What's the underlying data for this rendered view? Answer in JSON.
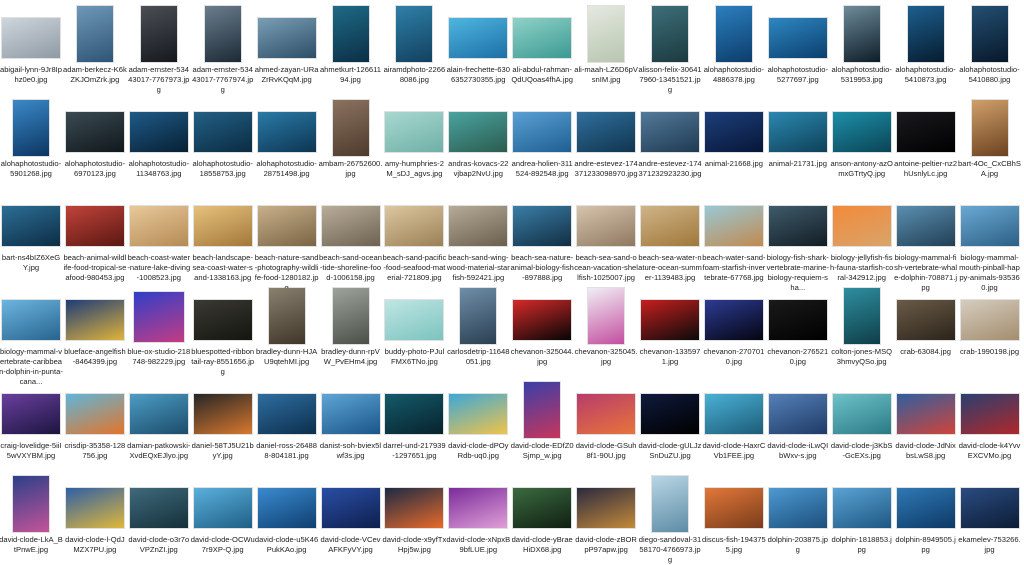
{
  "files": [
    {
      "name": "abigail-lynn-9Jr8Iphz0e0.jpg",
      "shape": "landscape",
      "c1": "#cfd6dc",
      "c2": "#8e9aa5"
    },
    {
      "name": "adam-berkecz-K6kZKJOmZrk.jpg",
      "shape": "portrait",
      "c1": "#6e97b8",
      "c2": "#2f5576"
    },
    {
      "name": "adam-ernster-53443017-7767973.jpg",
      "shape": "portrait",
      "c1": "#4b4f55",
      "c2": "#15181d"
    },
    {
      "name": "adam-ernster-53443017-7767974.jpg",
      "shape": "portrait",
      "c1": "#6a7d8d",
      "c2": "#1d2a36"
    },
    {
      "name": "ahmed-zayan-URaZrRvKQqM.jpg",
      "shape": "landscape",
      "c1": "#7a9fb5",
      "c2": "#2c4e66"
    },
    {
      "name": "ahmetkurt-12661194.jpg",
      "shape": "portrait",
      "c1": "#1e6a86",
      "c2": "#0b2f45"
    },
    {
      "name": "airamdphoto-22668086.jpg",
      "shape": "portrait",
      "c1": "#2f7fa8",
      "c2": "#12415f"
    },
    {
      "name": "alain-frechette-6306352730355.jpg",
      "shape": "landscape",
      "c1": "#4fb6e0",
      "c2": "#1c6fa6"
    },
    {
      "name": "ali-abdul-rahman-QdUQoas4fhA.jpg",
      "shape": "landscape",
      "c1": "#8fd1c8",
      "c2": "#3b9a92"
    },
    {
      "name": "ali-maah-LZ6D6pVsnIM.jpg",
      "shape": "portrait",
      "c1": "#e5e9e0",
      "c2": "#b8c6b0"
    },
    {
      "name": "alisson-felix-306417960-13451521.jpg",
      "shape": "portrait",
      "c1": "#3d6e78",
      "c2": "#1c3a40"
    },
    {
      "name": "alohaphotostudio-4886378.jpg",
      "shape": "portrait",
      "c1": "#2b7fbf",
      "c2": "#0d3d6b"
    },
    {
      "name": "alohaphotostudio-5277697.jpg",
      "shape": "landscape",
      "c1": "#2e87c2",
      "c2": "#0b3f6e"
    },
    {
      "name": "alohaphotostudio-5319953.jpg",
      "shape": "portrait",
      "c1": "#6e8a99",
      "c2": "#0d1d28"
    },
    {
      "name": "alohaphotostudio-5410873.jpg",
      "shape": "portrait",
      "c1": "#1d5f8e",
      "c2": "#061c30"
    },
    {
      "name": "alohaphotostudio-5410880.jpg",
      "shape": "portrait",
      "c1": "#244f73",
      "c2": "#08182a"
    },
    {
      "name": "alohaphotostudio-5901268.jpg",
      "shape": "portrait",
      "c1": "#3a89c8",
      "c2": "#0c3562"
    },
    {
      "name": "alohaphotostudio-6970123.jpg",
      "shape": "landscape",
      "c1": "#3a4a52",
      "c2": "#10181c"
    },
    {
      "name": "alohaphotostudio-11348763.jpg",
      "shape": "landscape",
      "c1": "#1f5a87",
      "c2": "#072034"
    },
    {
      "name": "alohaphotostudio-18558753.jpg",
      "shape": "landscape",
      "c1": "#235f85",
      "c2": "#0a2c42"
    },
    {
      "name": "alohaphotostudio-28751498.jpg",
      "shape": "landscape",
      "c1": "#2a7aa8",
      "c2": "#0d3552"
    },
    {
      "name": "ambam-26752600.jpg",
      "shape": "portrait",
      "c1": "#8a7260",
      "c2": "#4e3b2c"
    },
    {
      "name": "amy-humphries-2M_sDJ_agvs.jpg",
      "shape": "landscape",
      "c1": "#a8d8d0",
      "c2": "#6fb0a6"
    },
    {
      "name": "andras-kovacs-22vjbap2NvU.jpg",
      "shape": "landscape",
      "c1": "#4aa3a0",
      "c2": "#2b5c4f"
    },
    {
      "name": "andrea-holien-311524-892548.jpg",
      "shape": "landscape",
      "c1": "#5aa0d4",
      "c2": "#1e5f92"
    },
    {
      "name": "andre-estevez-174371233098970.jpg",
      "shape": "landscape",
      "c1": "#2f6f9c",
      "c2": "#10354f"
    },
    {
      "name": "andre-estevez-174371232923230.jpg",
      "shape": "landscape",
      "c1": "#53799a",
      "c2": "#1f3a52"
    },
    {
      "name": "animal-21668.jpg",
      "shape": "landscape",
      "c1": "#1c3f7a",
      "c2": "#081638"
    },
    {
      "name": "animal-21731.jpg",
      "shape": "landscape",
      "c1": "#2b88b0",
      "c2": "#0e4159"
    },
    {
      "name": "anson-antony-azOmxGTrtyQ.jpg",
      "shape": "landscape",
      "c1": "#1d8fa8",
      "c2": "#0a4455"
    },
    {
      "name": "antoine-peltier-nz2hUsnlyLc.jpg",
      "shape": "landscape",
      "c1": "#1a1a1f",
      "c2": "#000000"
    },
    {
      "name": "bart-4Oc_CxCBhSA.jpg",
      "shape": "portrait",
      "c1": "#d0a06b",
      "c2": "#6b4220"
    },
    {
      "name": "bart-ns4bIZ6XeGY.jpg",
      "shape": "landscape",
      "c1": "#2c6e95",
      "c2": "#0d2d45"
    },
    {
      "name": "beach-animal-wildlife-food-tropical-seafood-980453.jpg",
      "shape": "landscape",
      "c1": "#c0433a",
      "c2": "#5a1812"
    },
    {
      "name": "beach-coast-water-nature-lake-diving-1008523.jpg",
      "shape": "landscape",
      "c1": "#e8c89a",
      "c2": "#b58b55"
    },
    {
      "name": "beach-landscape-sea-coast-water-sand-1338163.jpg",
      "shape": "landscape",
      "c1": "#e6c17d",
      "c2": "#a3783a"
    },
    {
      "name": "beach-nature-sand-photography-wildlife-food-1280182.jpg",
      "shape": "landscape",
      "c1": "#c8b08a",
      "c2": "#7a6444"
    },
    {
      "name": "beach-sand-ocean-tide-shoreline-food-1006158.jpg",
      "shape": "landscape",
      "c1": "#b9ad9a",
      "c2": "#6d6151"
    },
    {
      "name": "beach-sand-pacific-food-seafood-material-721809.jpg",
      "shape": "landscape",
      "c1": "#dcc7a0",
      "c2": "#9b8056"
    },
    {
      "name": "beach-sand-wing-wood-material-starfish-592421.jpg",
      "shape": "landscape",
      "c1": "#b6aa98",
      "c2": "#6a5e4c"
    },
    {
      "name": "beach-sea-nature-animal-biology-fish-897888.jpg",
      "shape": "landscape",
      "c1": "#3a7ea6",
      "c2": "#122e44"
    },
    {
      "name": "beach-sea-sand-ocean-vacation-shellfish-1025007.jpg",
      "shape": "landscape",
      "c1": "#d6c4ad",
      "c2": "#8f7860"
    },
    {
      "name": "beach-sea-water-nature-ocean-summer-1139483.jpg",
      "shape": "landscape",
      "c1": "#cfb487",
      "c2": "#a0773b"
    },
    {
      "name": "beach-water-sand-foam-starfish-invertebrate-67768.jpg",
      "shape": "landscape",
      "c1": "#9ac8d6",
      "c2": "#c08a4f"
    },
    {
      "name": "biology-fish-shark-vertebrate-marine-biology-requiem-sha...",
      "shape": "landscape",
      "c1": "#3f5b6b",
      "c2": "#121d24"
    },
    {
      "name": "biology-jellyfish-fish-fauna-starfish-coral-342912.jpg",
      "shape": "landscape",
      "c1": "#f28a3a",
      "c2": "#d9a46a"
    },
    {
      "name": "biology-mammal-fish-vertebrate-whale-dolphin-708871.jpg",
      "shape": "landscape",
      "c1": "#5b8fb0",
      "c2": "#213f55"
    },
    {
      "name": "biology-mammal-mouth-pinball-happy-animals-935360.jpg",
      "shape": "landscape",
      "c1": "#6aa9d4",
      "c2": "#2c5f85"
    },
    {
      "name": "biology-mammal-vertebrate-caribbean-dolphin-in-punta-cana...",
      "shape": "landscape",
      "c1": "#6cb5e0",
      "c2": "#27648f"
    },
    {
      "name": "blueface-angelfish-8464399.jpg",
      "shape": "landscape",
      "c1": "#1d3c78",
      "c2": "#e0b33a"
    },
    {
      "name": "blue-ox-studio-218748-982229.jpg",
      "shape": "square",
      "c1": "#2f3fc8",
      "c2": "#c43c84"
    },
    {
      "name": "bluespotted-ribbontail-ray-8551656.jpg",
      "shape": "landscape",
      "c1": "#3a3a33",
      "c2": "#151510"
    },
    {
      "name": "bradley-dunn-HJAU9qtehMI.jpg",
      "shape": "portrait",
      "c1": "#8a8070",
      "c2": "#3f3628"
    },
    {
      "name": "bradley-dunn-rpVW_PvEHm4.jpg",
      "shape": "portrait",
      "c1": "#9ea39c",
      "c2": "#4a4f48"
    },
    {
      "name": "buddy-photo-PJulFMX6TNo.jpg",
      "shape": "landscape",
      "c1": "#bfe6e3",
      "c2": "#7cc3bf"
    },
    {
      "name": "carlosdetrip-11648051.jpg",
      "shape": "portrait",
      "c1": "#6f8ea8",
      "c2": "#2a3f52"
    },
    {
      "name": "chevanon-325044.jpg",
      "shape": "landscape",
      "c1": "#d72a2a",
      "c2": "#050505"
    },
    {
      "name": "chevanon-325045.jpg",
      "shape": "portrait",
      "c1": "#f1eef5",
      "c2": "#c34fa0"
    },
    {
      "name": "chevanon-1335971.jpg",
      "shape": "landscape",
      "c1": "#c61f1f",
      "c2": "#0a0a0a"
    },
    {
      "name": "chevanon-2707010.jpg",
      "shape": "landscape",
      "c1": "#2c3b94",
      "c2": "#050510"
    },
    {
      "name": "chevanon-2765210.jpg",
      "shape": "landscape",
      "c1": "#1a1a1a",
      "c2": "#000000"
    },
    {
      "name": "colton-jones-MSQ3hmvyQSo.jpg",
      "shape": "portrait",
      "c1": "#2e8ea0",
      "c2": "#0f3e48"
    },
    {
      "name": "crab-63084.jpg",
      "shape": "landscape",
      "c1": "#6a5b48",
      "c2": "#2c241a"
    },
    {
      "name": "crab-1990198.jpg",
      "shape": "landscape",
      "c1": "#d6cdbf",
      "c2": "#a38d6e"
    },
    {
      "name": "craig-lovelidge-5iiI5wVXYBM.jpg",
      "shape": "landscape",
      "c1": "#6a3f9e",
      "c2": "#1c1540"
    },
    {
      "name": "crisdip-35358-128756.jpg",
      "shape": "landscape",
      "c1": "#5fb6d9",
      "c2": "#e3742a"
    },
    {
      "name": "damian-patkowski-XvdEQxEJlyo.jpg",
      "shape": "landscape",
      "c1": "#4d9cc4",
      "c2": "#1b4c6b"
    },
    {
      "name": "daniel-58TJ5U21byY.jpg",
      "shape": "landscape",
      "c1": "#262626",
      "c2": "#d8782e"
    },
    {
      "name": "daniel-ross-264888-804181.jpg",
      "shape": "landscape",
      "c1": "#2f6da0",
      "c2": "#0c2f4d"
    },
    {
      "name": "danist-soh-bviex5lwf3s.jpg",
      "shape": "landscape",
      "c1": "#5fa5d6",
      "c2": "#1a5589"
    },
    {
      "name": "darrel-und-217939-1297651.jpg",
      "shape": "landscape",
      "c1": "#145a6b",
      "c2": "#07232c"
    },
    {
      "name": "david-clode-dPOyRdb-uq0.jpg",
      "shape": "landscape",
      "c1": "#3da8d8",
      "c2": "#f0c34a"
    },
    {
      "name": "david-clode-EDfZ0Sjmp_w.jpg",
      "shape": "portrait",
      "c1": "#3a3fa8",
      "c2": "#c7365c"
    },
    {
      "name": "david-clode-GSuh8f1-90U.jpg",
      "shape": "landscape",
      "c1": "#b83c6b",
      "c2": "#e7743a"
    },
    {
      "name": "david-clode-gULJzSnDuZU.jpg",
      "shape": "landscape",
      "c1": "#0f1a3c",
      "c2": "#000000"
    },
    {
      "name": "david-clode-HaxrCVb1FEE.jpg",
      "shape": "landscape",
      "c1": "#4ab1d6",
      "c2": "#1d5c78"
    },
    {
      "name": "david-clode-iLwQIbWxv-s.jpg",
      "shape": "landscape",
      "c1": "#5580b8",
      "c2": "#1f3b66"
    },
    {
      "name": "david-clode-j3KbS-GcEXs.jpg",
      "shape": "landscape",
      "c1": "#6ec2c8",
      "c2": "#2a7a86"
    },
    {
      "name": "david-clode-JdNixbsLwS8.jpg",
      "shape": "landscape",
      "c1": "#2f5fa0",
      "c2": "#d0443a"
    },
    {
      "name": "david-clode-k4YvvEXCVMo.jpg",
      "shape": "landscape",
      "c1": "#2a3f70",
      "c2": "#b0282a"
    },
    {
      "name": "david-clode-LkA_BtPnwE.jpg",
      "shape": "portrait",
      "c1": "#2c3f8a",
      "c2": "#c45498"
    },
    {
      "name": "david-clode-l-QdJMZX7PU.jpg",
      "shape": "landscape",
      "c1": "#2f5fa6",
      "c2": "#e0b83a"
    },
    {
      "name": "david-clode-o3r7oVPZnZI.jpg",
      "shape": "landscape",
      "c1": "#3f6a7c",
      "c2": "#15303a"
    },
    {
      "name": "david-clode-OCWu7r9XP-Q.jpg",
      "shape": "landscape",
      "c1": "#5ab0dc",
      "c2": "#1f5f86"
    },
    {
      "name": "david-clode-u5K46PukKAo.jpg",
      "shape": "landscape",
      "c1": "#3a8ad0",
      "c2": "#0f3f70"
    },
    {
      "name": "david-clode-VCevAFKFyVY.jpg",
      "shape": "landscape",
      "c1": "#2a4ea6",
      "c2": "#0e1f4d"
    },
    {
      "name": "david-clode-x9yfTxHpj5w.jpg",
      "shape": "landscape",
      "c1": "#1c2a45",
      "c2": "#e86a2a"
    },
    {
      "name": "david-clode-xNpxB9bfLUE.jpg",
      "shape": "landscape",
      "c1": "#7a2c9a",
      "c2": "#e0a0d8"
    },
    {
      "name": "david-clode-yBraeHiDX68.jpg",
      "shape": "landscape",
      "c1": "#3b6a40",
      "c2": "#101f12"
    },
    {
      "name": "david-clode-zBORpP97apw.jpg",
      "shape": "landscape",
      "c1": "#2c2a3f",
      "c2": "#c38a3a"
    },
    {
      "name": "diego-sandoval-3158170-4766973.jpg",
      "shape": "portrait",
      "c1": "#b9d6e4",
      "c2": "#5e8ca6"
    },
    {
      "name": "discus-fish-1943755.jpg",
      "shape": "landscape",
      "c1": "#e2783a",
      "c2": "#7a3c1a"
    },
    {
      "name": "dolphin-203875.jpg",
      "shape": "landscape",
      "c1": "#4d9ad2",
      "c2": "#1c4e7c"
    },
    {
      "name": "dolphin-1818853.jpg",
      "shape": "landscape",
      "c1": "#5aa3d3",
      "c2": "#1e5784"
    },
    {
      "name": "dolphin-8949505.jpg",
      "shape": "landscape",
      "c1": "#2f79b5",
      "c2": "#0d3966"
    },
    {
      "name": "ekamelev-753266.jpg",
      "shape": "landscape",
      "c1": "#2a4c80",
      "c2": "#0d1c36"
    }
  ]
}
